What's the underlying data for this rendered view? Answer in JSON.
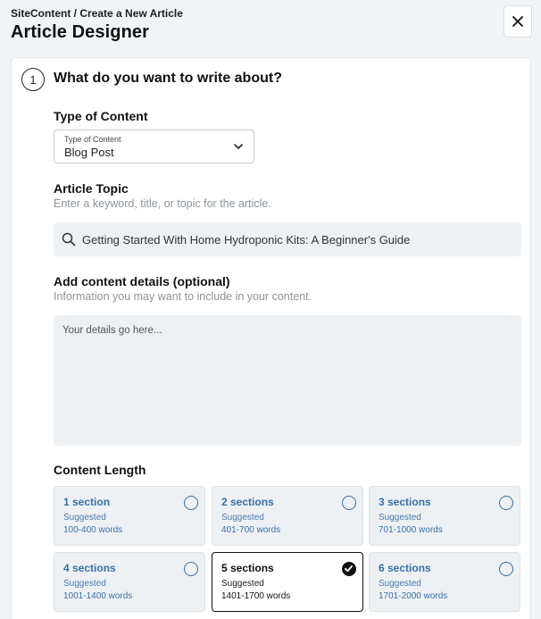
{
  "header": {
    "breadcrumb": "SiteContent / Create a New Article",
    "title": "Article Designer"
  },
  "step": {
    "number": "1",
    "title": "What do you want to write about?"
  },
  "content_type": {
    "label": "Type of Content",
    "float_label": "Type of Content",
    "value": "Blog Post"
  },
  "topic": {
    "label": "Article Topic",
    "help": "Enter a keyword, title, or topic for the article.",
    "value": "Getting Started With Home Hydroponic Kits: A Beginner's Guide"
  },
  "details": {
    "label": "Add content details (optional)",
    "help": "Information you may want to include in your content.",
    "placeholder": "Your details go here..."
  },
  "length": {
    "label": "Content Length",
    "options": [
      {
        "title": "1 section",
        "sub": "Suggested",
        "words": "100-400 words",
        "selected": false
      },
      {
        "title": "2 sections",
        "sub": "Suggested",
        "words": "401-700 words",
        "selected": false
      },
      {
        "title": "3 sections",
        "sub": "Suggested",
        "words": "701-1000 words",
        "selected": false
      },
      {
        "title": "4 sections",
        "sub": "Suggested",
        "words": "1001-1400 words",
        "selected": false
      },
      {
        "title": "5 sections",
        "sub": "Suggested",
        "words": "1401-1700 words",
        "selected": true
      },
      {
        "title": "6 sections",
        "sub": "Suggested",
        "words": "1701-2000 words",
        "selected": false
      }
    ]
  },
  "icons": {
    "close": "close-icon",
    "chevron": "chevron-down-icon",
    "search": "search-icon",
    "check": "check-icon"
  },
  "colors": {
    "accent": "#3a6fa8",
    "field_bg": "#edf1f4",
    "page_bg": "#f1f4f6"
  }
}
